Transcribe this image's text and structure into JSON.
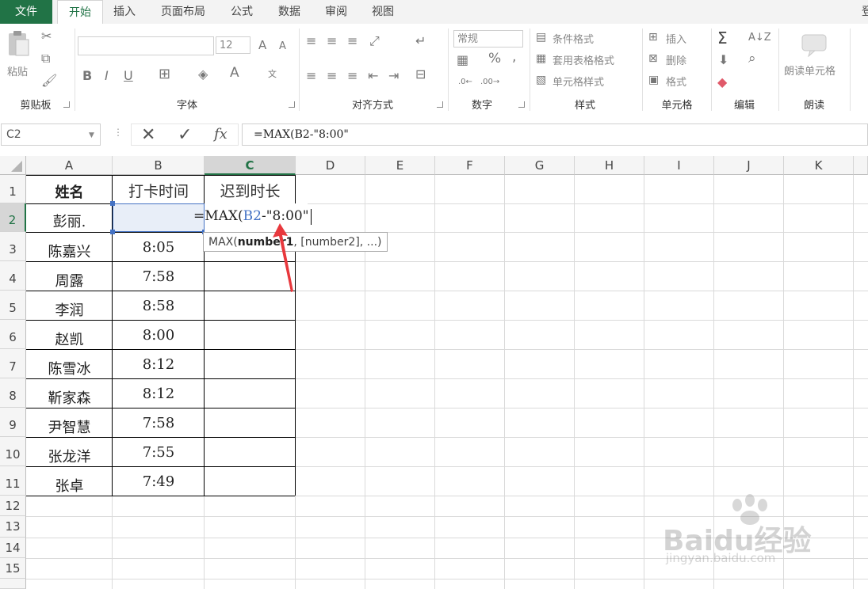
{
  "tabs": [
    "文件",
    "开始",
    "插入",
    "页面布局",
    "公式",
    "数据",
    "审阅",
    "视图"
  ],
  "account_initial": "登",
  "ribbon": {
    "paste_label": "粘贴",
    "font_size": "12",
    "bold_label": "B",
    "italic_label": "I",
    "underline_label": "U",
    "number_format": "常规",
    "percent_label": "%",
    "comma_label": ",",
    "conditional_format": "条件格式",
    "format_as_table": "套用表格格式",
    "cell_styles": "单元格样式",
    "insert": "插入",
    "delete": "删除",
    "format": "格式",
    "read_cell": "朗读单元格",
    "groups": [
      "剪贴板",
      "字体",
      "对齐方式",
      "数字",
      "样式",
      "单元格",
      "编辑",
      "朗读"
    ]
  },
  "formula_bar": {
    "name_box": "C2",
    "fx_label": "fx",
    "formula": "=MAX(B2-\"8:00\""
  },
  "sheet": {
    "columns": [
      "A",
      "B",
      "C",
      "D",
      "E",
      "F",
      "G",
      "H",
      "I",
      "J",
      "K"
    ],
    "rows": [
      "1",
      "2",
      "3",
      "4",
      "5",
      "6",
      "7",
      "8",
      "9",
      "10",
      "11",
      "12",
      "13",
      "14",
      "15"
    ],
    "headers": [
      "姓名",
      "打卡时间",
      "迟到时长"
    ],
    "data": [
      {
        "name": "彭丽.",
        "time": ""
      },
      {
        "name": "陈嘉兴",
        "time": "8:05"
      },
      {
        "name": "周露",
        "time": "7:58"
      },
      {
        "name": "李润",
        "time": "8:58"
      },
      {
        "name": "赵凯",
        "time": "8:00"
      },
      {
        "name": "陈雪冰",
        "time": "8:12"
      },
      {
        "name": "靳家森",
        "time": "8:12"
      },
      {
        "name": "尹智慧",
        "time": "7:58"
      },
      {
        "name": "张龙洋",
        "time": "7:55"
      },
      {
        "name": "张卓",
        "time": "7:49"
      }
    ],
    "edit_formula": {
      "prefix": "=MAX(",
      "ref": "B2",
      "suffix": "-\"8:00\""
    },
    "tooltip": {
      "fn": "MAX(",
      "bold_arg": "number1",
      "rest": ", [number2], ...)"
    }
  },
  "watermark": {
    "brand": "Baidu经验",
    "url": "jingyan.baidu.com"
  },
  "colors": {
    "accent": "#217346",
    "ref_blue": "#4472c4",
    "arrow_red": "#e8383d"
  }
}
